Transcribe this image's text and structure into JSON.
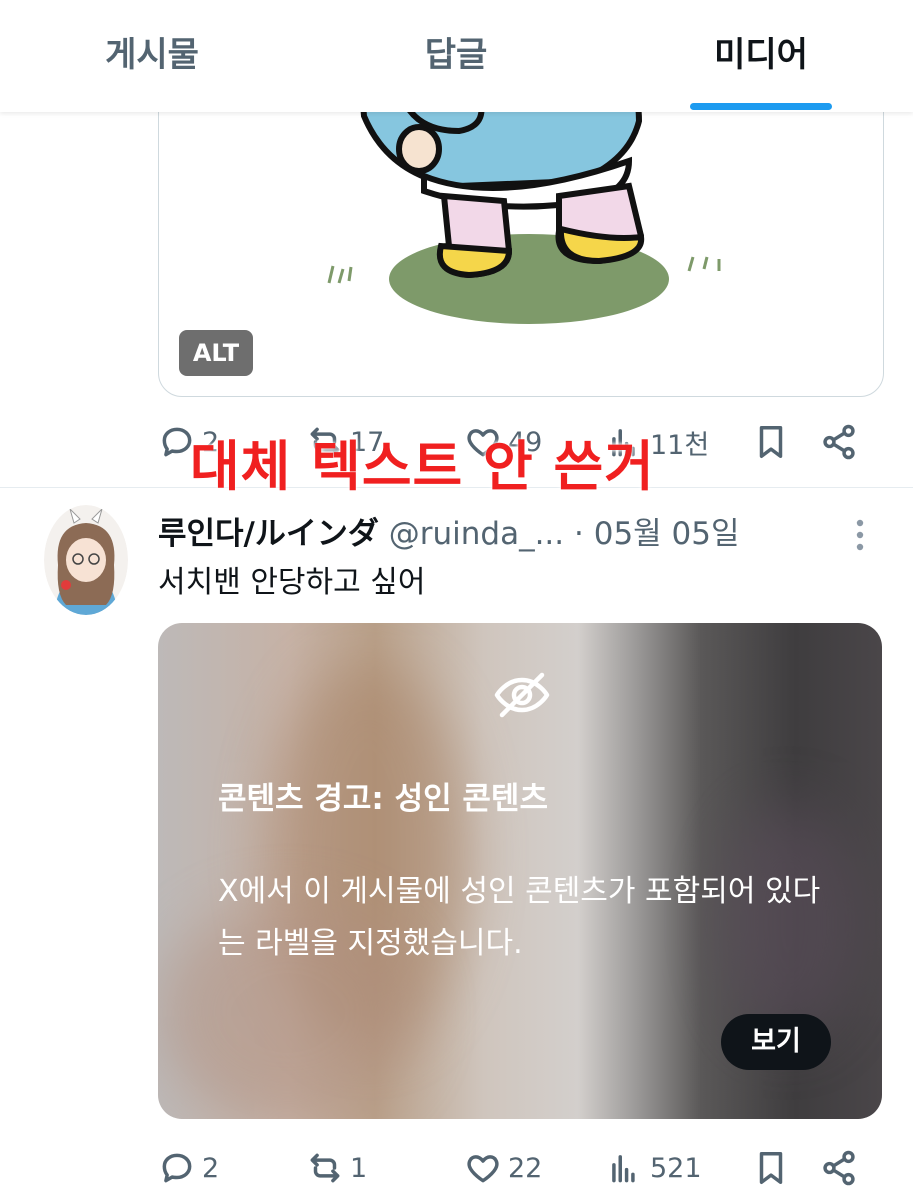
{
  "tabs": [
    {
      "label": "게시물",
      "active": false
    },
    {
      "label": "답글",
      "active": false
    },
    {
      "label": "미디어",
      "active": true
    }
  ],
  "accent_color": "#1d9bf0",
  "first_post": {
    "alt_badge": "ALT",
    "actions": {
      "replies": "2",
      "reposts": "17",
      "likes": "49",
      "views": "11천"
    }
  },
  "overlay_annotation": "대체 텍스트 안 쓴거",
  "second_post": {
    "display_name": "루인다/ルインダ",
    "handle": "@ruinda_...",
    "separator": "·",
    "date": "05월 05일",
    "text": "서치밴 안당하고 싶어",
    "content_warning": {
      "title": "콘텐츠 경고: 성인 콘텐츠",
      "body": "X에서 이 게시물에 성인 콘텐츠가 포함되어 있다는 라벨을 지정했습니다.",
      "button": "보기"
    },
    "actions": {
      "replies": "2",
      "reposts": "1",
      "likes": "22",
      "views": "521"
    }
  }
}
